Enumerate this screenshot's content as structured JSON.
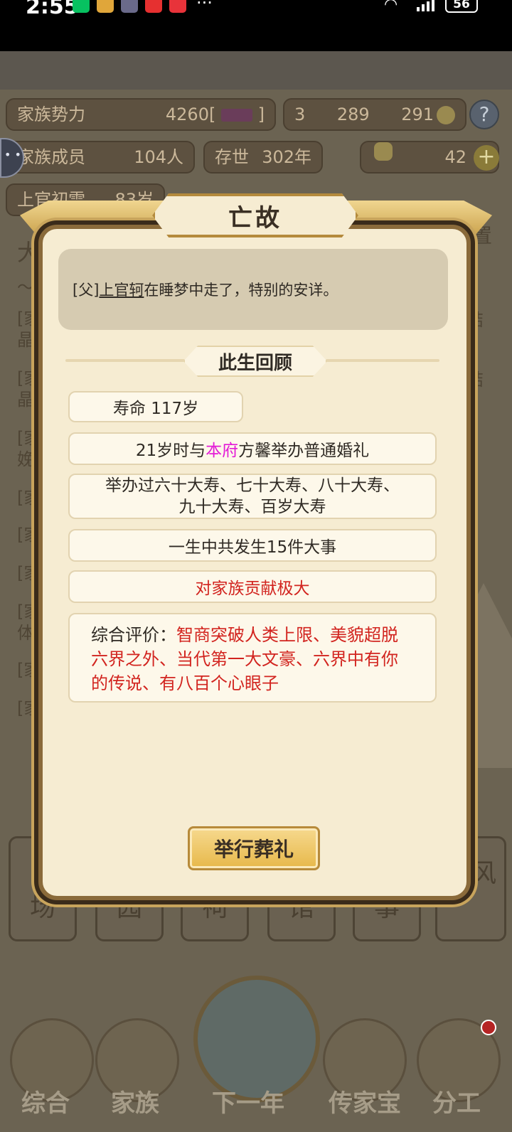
{
  "status_bar": {
    "time": "2:55",
    "more": "···",
    "battery": "56",
    "network": "4G"
  },
  "hud": {
    "family_power_label": "家族势力",
    "family_power_value": "4260",
    "family_power_bracket_open": "[",
    "family_power_bracket_close": "]",
    "gold": "3",
    "silver": "289",
    "coins": "291",
    "family_members_label": "家族成员",
    "family_members_value": "104人",
    "existence_label": "存世",
    "existence_value": "302年",
    "ingots": "42",
    "elder_label": "上官初雪",
    "elder_age": "83岁",
    "help": "?",
    "plus": "+"
  },
  "background_text": {
    "left": [
      "大",
      "〜",
      "[家",
      "晶",
      "[家",
      "晶",
      "[家",
      "娩",
      "[家",
      "[家",
      "[家",
      "[家",
      "体",
      "[家",
      "[家"
    ],
    "right": [
      "置",
      "结",
      "结"
    ],
    "cards": [
      "场",
      "园",
      "祠",
      "馆",
      "事",
      "家风"
    ],
    "nav": [
      "综合",
      "家族",
      "下一年",
      "传家宝",
      "分工"
    ]
  },
  "modal": {
    "title": "亡故",
    "message_prefix": "[父]",
    "message_name": "上官轲",
    "message_suffix": "在睡梦中走了，特别的安详。",
    "review_title": "此生回顾",
    "lifespan": "寿命 117岁",
    "marriage_prefix": "21岁时与",
    "marriage_house": "本府",
    "marriage_suffix": "方馨举办普通婚礼",
    "birthdays_line1": "举办过六十大寿、七十大寿、八十大寿、",
    "birthdays_line2": "九十大寿、百岁大寿",
    "events": "一生中共发生15件大事",
    "contribution": "对家族贡献极大",
    "evaluation_label": "综合评价：",
    "evaluation_text": "智商突破人类上限、美貌超脱六界之外、当代第一大文豪、六界中有你的传说、有八百个心眼子",
    "funeral_button": "举行葬礼"
  },
  "colors": {
    "accent_red": "#d2241f",
    "accent_magenta": "#e31ad6",
    "modal_bg": "#f6ecd2",
    "button_gold": "#e7b84a"
  }
}
